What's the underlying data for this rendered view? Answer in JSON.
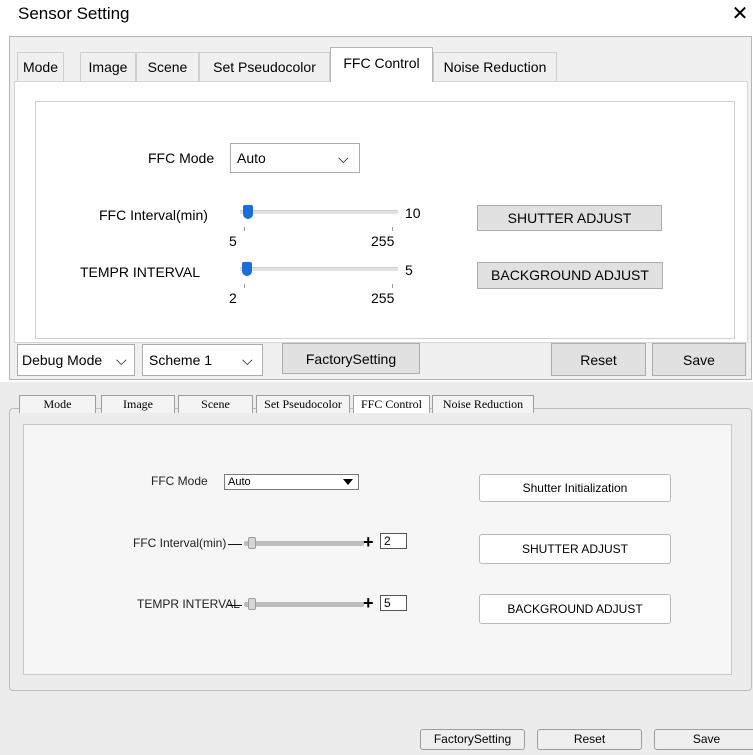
{
  "window": {
    "title": "Sensor Setting",
    "close_glyph": "✕"
  },
  "panel_top": {
    "tabs": [
      "Mode",
      "Image",
      "Scene",
      "Set Pseudocolor",
      "FFC Control",
      "Noise Reduction"
    ],
    "active_tab": "FFC Control",
    "ffc_mode": {
      "label": "FFC Mode",
      "value": "Auto"
    },
    "ffc_interval": {
      "label": "FFC Interval(min)",
      "value": "10",
      "min": "5",
      "max": "255",
      "slider_fraction": 0.02
    },
    "tempr_interval": {
      "label": "TEMPR INTERVAL",
      "value": "5",
      "min": "2",
      "max": "255",
      "slider_fraction": 0.01
    },
    "buttons": {
      "shutter_adjust": "SHUTTER ADJUST",
      "background_adjust": "BACKGROUND ADJUST"
    },
    "bottom_bar": {
      "debug_mode": "Debug Mode",
      "scheme": "Scheme 1",
      "factory_setting": "FactorySetting",
      "reset": "Reset",
      "save": "Save"
    }
  },
  "panel_bottom": {
    "tabs": [
      "Mode",
      "Image",
      "Scene",
      "Set Pseudocolor",
      "FFC Control",
      "Noise Reduction"
    ],
    "active_tab": "FFC Control",
    "ffc_mode": {
      "label": "FFC Mode",
      "value": "Auto"
    },
    "ffc_interval": {
      "label": "FFC Interval(min)",
      "value": "2",
      "minus": "—",
      "plus": "+",
      "slider_fraction": 0.02
    },
    "tempr_interval": {
      "label": "TEMPR INTERVAL",
      "value": "5",
      "minus": "—",
      "plus": "+",
      "slider_fraction": 0.02
    },
    "buttons": {
      "shutter_initialization": "Shutter Initialization",
      "shutter_adjust": "SHUTTER ADJUST",
      "background_adjust": "BACKGROUND ADJUST"
    },
    "footer": {
      "factory_setting": "FactorySetting",
      "reset": "Reset",
      "save": "Save"
    }
  },
  "colors": {
    "slider_thumb": "#1a6fd6",
    "panel_bg": "#f0f0f0",
    "bottom_bg": "#ececec"
  },
  "icons": {
    "close": "close-icon",
    "dropdown_top": "chevron-down-icon",
    "dropdown_bottom": "triangle-down-icon"
  }
}
